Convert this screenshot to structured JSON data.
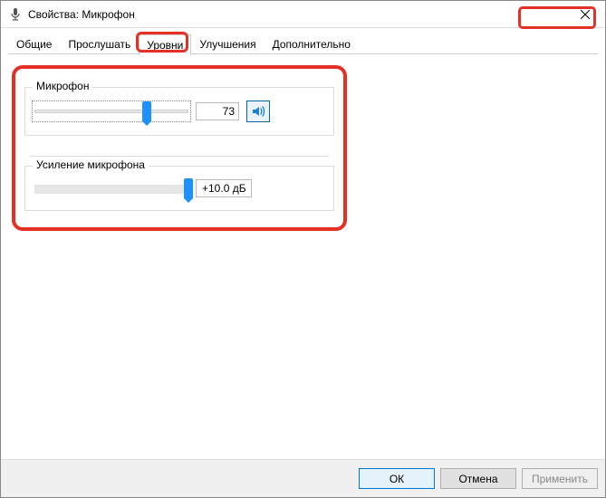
{
  "window": {
    "title": "Свойства: Микрофон"
  },
  "tabs": {
    "general": "Общие",
    "listen": "Прослушать",
    "levels": "Уровни",
    "enhancements": "Улучшения",
    "advanced": "Дополнительно"
  },
  "mic": {
    "group_label": "Микрофон",
    "value": "73",
    "percent": 73
  },
  "boost": {
    "group_label": "Усиление микрофона",
    "value": "+10.0 дБ",
    "percent": 100
  },
  "buttons": {
    "ok": "ОК",
    "cancel": "Отмена",
    "apply": "Применить"
  }
}
